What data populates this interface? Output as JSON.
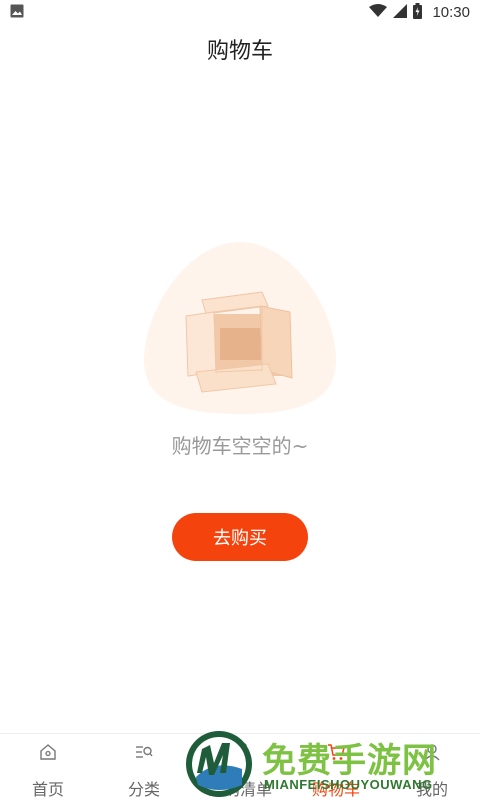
{
  "status_bar": {
    "time": "10:30",
    "icons": [
      "image-icon",
      "wifi-icon",
      "signal-icon",
      "battery-charging-icon"
    ]
  },
  "header": {
    "title": "购物车"
  },
  "empty_state": {
    "message": "购物车空空的~",
    "illustration": "empty-box-icon",
    "button_label": "去购买"
  },
  "bottom_nav": {
    "items": [
      {
        "label": "首页",
        "icon": "home-icon",
        "active": false
      },
      {
        "label": "分类",
        "icon": "category-search-icon",
        "active": false
      },
      {
        "label": "采购清单",
        "icon": "list-icon",
        "active": false
      },
      {
        "label": "购物车",
        "icon": "cart-icon",
        "active": true
      },
      {
        "label": "我的",
        "icon": "user-icon",
        "active": false
      }
    ]
  },
  "watermark": {
    "title": "免费手游网",
    "subtitle": "MIANFEISHOUYOUWANG",
    "logo_letter": "M"
  },
  "colors": {
    "accent": "#f5430e",
    "text_muted": "#999999",
    "box_light": "#fbe6d6"
  }
}
